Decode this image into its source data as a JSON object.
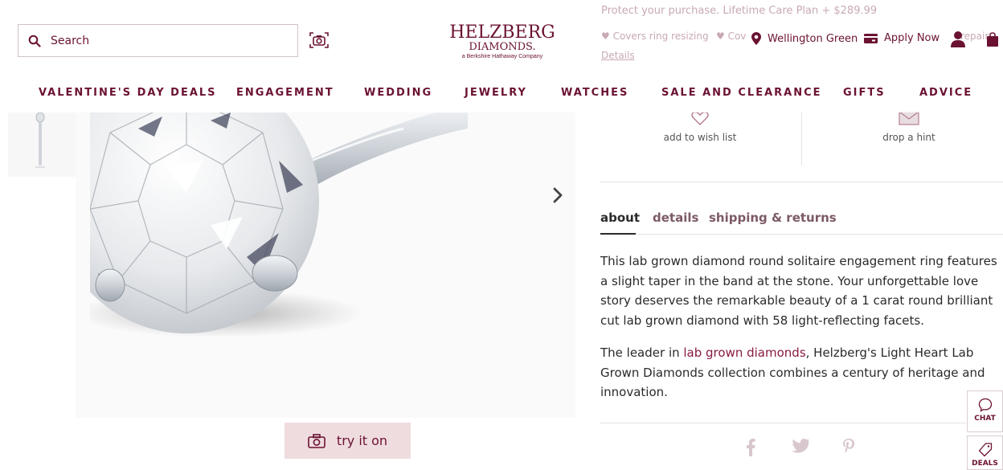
{
  "header": {
    "search": {
      "placeholder": "Search"
    },
    "logo": {
      "line1": "HELZBERG",
      "line2": "DIAMONDS.",
      "tagline": "a Berkshire Hathaway Company"
    },
    "store_label": "Wellington Green",
    "apply_label": "Apply Now",
    "behind": {
      "protect": "Protect your purchase. Lifetime Care Plan + $289.99",
      "covers1": "♥ Covers ring resizing",
      "covers2": "♥ Cov",
      "repair": "repair",
      "details": "Details"
    }
  },
  "nav": [
    "VALENTINE'S DAY DEALS",
    "ENGAGEMENT",
    "WEDDING",
    "JEWELRY",
    "WATCHES",
    "SALE AND CLEARANCE",
    "GIFTS",
    "ADVICE"
  ],
  "actions": {
    "wishlist": "add to wish list",
    "hint": "drop a hint"
  },
  "tabs": [
    "about",
    "details",
    "shipping & returns"
  ],
  "description": {
    "p1": "This lab grown diamond round solitaire engagement ring features a slight taper in the band at the stone. Your unforgettable love story deserves the remarkable beauty of a 1 carat round brilliant cut lab grown diamond with 58 light-reflecting facets.",
    "p2_before": "The leader in ",
    "p2_link": "lab grown diamonds",
    "p2_after": ", Helzberg's Light Heart Lab Grown Diamonds collection combines a century of heritage and innovation."
  },
  "try_on": "try it on",
  "side": {
    "chat": "CHAT",
    "deals": "DEALS"
  },
  "colors": {
    "brand": "#6b1233",
    "try_on_bg": "#efdcdf",
    "link": "#8a1a44",
    "social": "#d8c7cd"
  },
  "icons": [
    "search-icon",
    "camera-search-icon",
    "location-pin-icon",
    "credit-card-icon",
    "account-icon",
    "shopping-bag-icon",
    "chevron-right-icon",
    "heart-icon",
    "envelope-icon",
    "camera-icon",
    "facebook-icon",
    "twitter-icon",
    "pinterest-icon",
    "chat-icon",
    "tag-icon"
  ]
}
